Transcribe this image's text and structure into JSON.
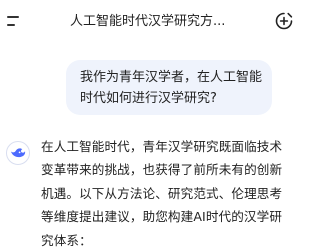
{
  "header": {
    "title": "人工智能时代汉学研究方...",
    "menu_icon": "menu-icon",
    "new_chat_icon": "new-chat-icon"
  },
  "conversation": {
    "user_message": "我作为青年汉学者，在人工智能时代如何进行汉学研究?",
    "assistant_icon": "whale-logo-icon",
    "assistant_message": "在人工智能时代，青年汉学研究既面临技术变革带来的挑战，也获得了前所未有的创新机遇。以下从方法论、研究范式、伦理思考等维度提出建议，助您构建AI时代的汉学研究体系："
  },
  "colors": {
    "bubble_bg": "#eff3fc",
    "logo_blue": "#4d6bfe",
    "text": "#222222"
  }
}
